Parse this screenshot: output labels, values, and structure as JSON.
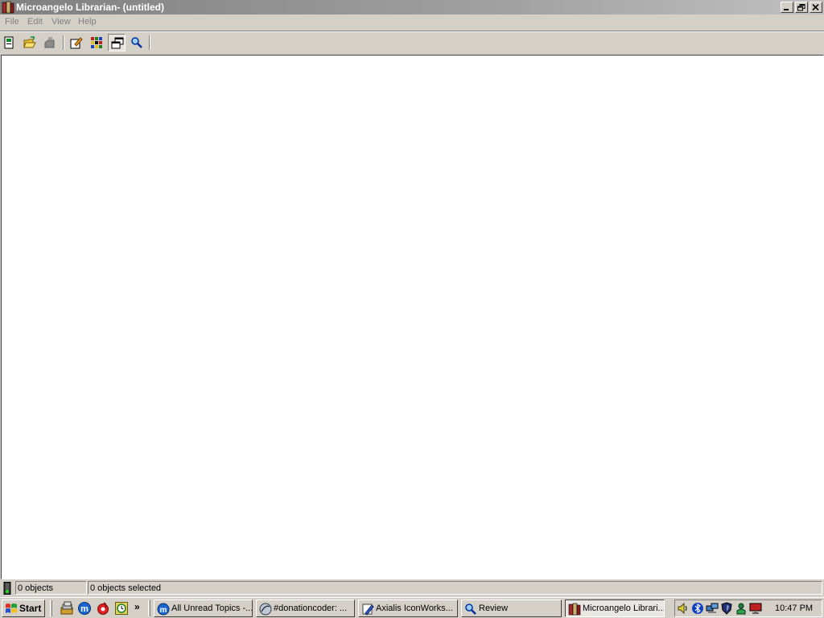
{
  "window": {
    "title": "Microangelo Librarian- (untitled)"
  },
  "menu": [
    {
      "label": "File"
    },
    {
      "label": "Edit"
    },
    {
      "label": "View"
    },
    {
      "label": "Help"
    }
  ],
  "toolbar": {
    "buttons": [
      {
        "icon": "new-icon"
      },
      {
        "icon": "open-folder-icon"
      },
      {
        "icon": "save-icon"
      },
      {
        "icon": "edit-icon"
      },
      {
        "icon": "grid-icon"
      },
      {
        "icon": "windows-icon"
      },
      {
        "icon": "magnifier-icon"
      }
    ]
  },
  "status": {
    "objects": "0 objects",
    "selected": "0 objects selected"
  },
  "taskbar": {
    "start_label": "Start",
    "quick_launch": [
      {
        "icon": "folder-stack-icon"
      },
      {
        "icon": "messenger-m-icon"
      },
      {
        "icon": "red-app-icon"
      },
      {
        "icon": "clock-app-icon"
      }
    ],
    "chevron": "»",
    "tasks": [
      {
        "label": "All Unread Topics -...",
        "icon": "messenger-m-icon"
      },
      {
        "label": "#donationcoder: ...",
        "icon": "irc-globe-icon"
      },
      {
        "label": "Axialis IconWorks...",
        "icon": "pencil-icon"
      },
      {
        "label": "Review",
        "icon": "magnifier-icon"
      },
      {
        "label": "Microangelo Librari...",
        "icon": "book-icon"
      }
    ],
    "clock": "10:47 PM"
  },
  "colors": {
    "face": "#d4d0c8",
    "title_inactive": "#808080",
    "workarea": "#ffffff"
  }
}
